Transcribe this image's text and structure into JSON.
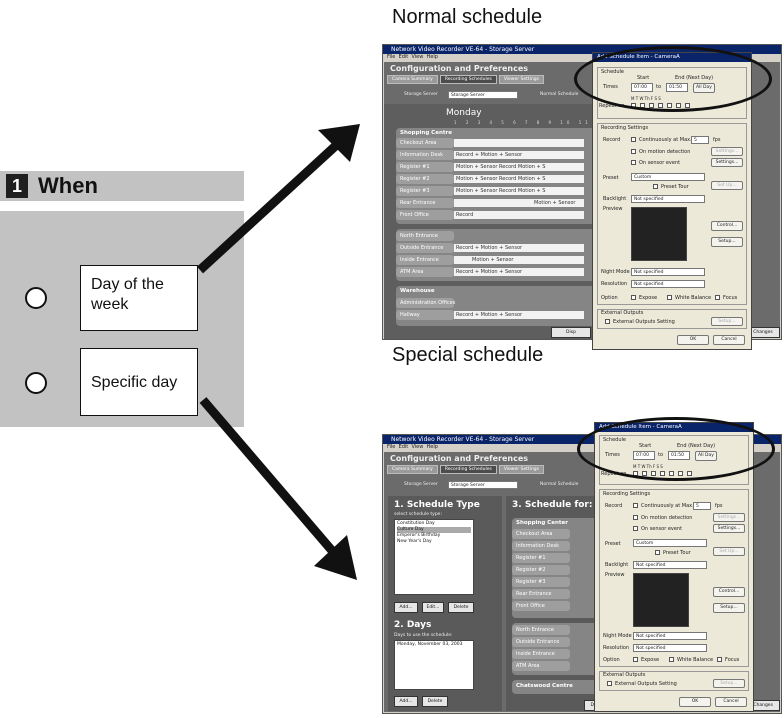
{
  "when": {
    "number": "1",
    "title": "When"
  },
  "options": [
    {
      "label": "Day of the week"
    },
    {
      "label": "Specific day"
    }
  ],
  "captions": {
    "normal": "Normal schedule",
    "special": "Special schedule"
  },
  "app": {
    "window_title": "Network Video Recorder VE-64 - Storage Server",
    "menu": [
      "File",
      "Edit",
      "View",
      "Help"
    ],
    "header": "Configuration and Preferences",
    "tabs": [
      "Camera Summary",
      "Recording Schedules",
      "Viewer Settings"
    ],
    "storage_label": "Storage Server",
    "storage_value": "Storage Server",
    "normal_radio": "Normal Schedule",
    "day_label": "Monday",
    "hours": "1 2 3 4 5 6 7 8 9 10 11",
    "groups": [
      {
        "name": "Shopping Centre",
        "cams": [
          {
            "name": "Checkout Area",
            "bar": ""
          },
          {
            "name": "Information Desk",
            "bar": "Record + Motion + Sensor"
          },
          {
            "name": "Register #1",
            "bar": "Motion + Sensor    Record    Motion + S"
          },
          {
            "name": "Register #2",
            "bar": "Motion + Sensor    Record    Motion + S"
          },
          {
            "name": "Register #3",
            "bar": "Motion + Sensor    Record    Motion + S"
          },
          {
            "name": "Rear Entrance",
            "bar": "Motion + Sensor"
          },
          {
            "name": "Front Office",
            "bar": "Record"
          }
        ]
      },
      {
        "name": "North Entrance",
        "cams": [
          {
            "name": "Outside Entrance",
            "bar": "Record + Motion + Sensor"
          },
          {
            "name": "Inside Entrance",
            "bar": "Motion + Sensor"
          },
          {
            "name": "ATM Area",
            "bar": "Record + Motion + Sensor"
          }
        ]
      },
      {
        "name": "Warehouse",
        "cams": [
          {
            "name": "Administration Offices",
            "bar": ""
          },
          {
            "name": "Hallway",
            "bar": "Record + Motion + Sensor"
          }
        ]
      }
    ],
    "bottom_btn": "Disp",
    "changes_btn": "Changes"
  },
  "special_app": {
    "schedule_type_title": "1. Schedule Type",
    "schedule_type_hint": "select schedule type:",
    "schedule_types": [
      "Constitution Day",
      "Culture Day",
      "Emperor's Birthday",
      "New Year's Day"
    ],
    "btn_add": "Add...",
    "btn_edit": "Edit...",
    "btn_delete": "Delete",
    "days_title": "2. Days",
    "days_hint": "Days to use the schedule:",
    "days": [
      "Monday, November 03, 2003"
    ],
    "schedule_for": "3. Schedule for: C",
    "groups": [
      {
        "name": "Shopping Center",
        "cams": [
          "Checkout Area",
          "Information Desk",
          "Register #1",
          "Register #2",
          "Register #3",
          "Rear Entrance",
          "Front Office"
        ]
      },
      {
        "name": "North Entrance",
        "cams": [
          "Outside Entrance",
          "Inside Entrance",
          "ATM Area"
        ]
      },
      {
        "name": "Chatswood Centre",
        "cams": []
      }
    ],
    "bottom_btn": "Dis",
    "changes_btn": "d Changes"
  },
  "dialog": {
    "title": "Add Schedule Item - CameraA",
    "schedule_label": "Schedule",
    "start_label": "Start",
    "end_label": "End (Next Day)",
    "times_label": "Times",
    "start_time": "07:00",
    "to_label": "to",
    "end_time": "01:50",
    "allday_btn": "All Day",
    "days_letters": "M  T  W  Th  F  S  S",
    "repeat_label": "Repeat on",
    "recording_settings": "Recording Settings",
    "record_label": "Record",
    "continuous_label": "Continuously at Max.",
    "fps_value": "5",
    "fps_label": "fps",
    "motion_label": "On motion detection",
    "sensor_label": "On sensor event",
    "settings_btn": "Settings...",
    "preset_label": "Preset",
    "preset_value": "Custom",
    "preset_tour": "Preset Tour",
    "setup_btn": "Set Up...",
    "backlight_label": "Backlight",
    "backlight_value": "Not specified",
    "preview_label": "Preview",
    "control_btn": "Control...",
    "setup2_btn": "Setup...",
    "night_label": "Night Mode",
    "night_value": "Not specified",
    "resolution_label": "Resolution",
    "resolution_value": "Not specified",
    "option_label": "Option",
    "expose": "Expose",
    "white_balance": "White Balance",
    "focus": "Focus",
    "external_outputs": "External Outputs",
    "ext_setting": "External Outputs Setting",
    "setup3_btn": "Setup...",
    "ok_btn": "OK",
    "cancel_btn": "Cancel"
  }
}
